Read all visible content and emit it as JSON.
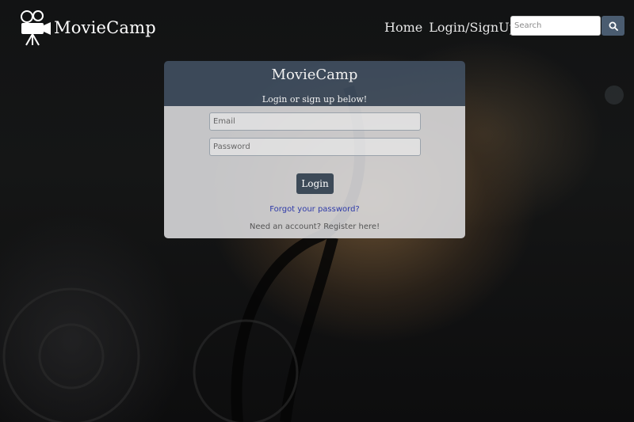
{
  "navbar": {
    "brand": "MovieCamp",
    "logo_icon": "movie-camera-icon",
    "links": [
      {
        "label": "Home"
      },
      {
        "label": "Login/SignUp"
      }
    ],
    "search": {
      "placeholder": "Search",
      "value": "",
      "icon": "search-icon"
    }
  },
  "login_card": {
    "title": "MovieCamp",
    "subtitle": "Login or sign up below!",
    "email_placeholder": "Email",
    "password_placeholder": "Password",
    "login_label": "Login",
    "forgot_link": "Forgot your password?",
    "register_text": "Need an account? Register here!"
  },
  "colors": {
    "card_header": "#465569",
    "login_button": "#3d4a58",
    "search_button": "#4a5c70",
    "forgot_link": "#2e3aa8"
  }
}
